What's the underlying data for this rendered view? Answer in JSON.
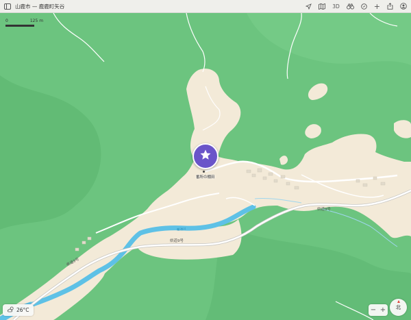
{
  "window": {
    "title": "山鹿市 — 鹿鹿町矢谷",
    "toolbar": {
      "sidebar_icon": "sidebar-icon",
      "location_icon": "location-arrow-icon",
      "map_mode_icon": "map-icon",
      "three_d_label": "3D",
      "binoculars_icon": "binoculars-icon",
      "guides_icon": "guides-icon",
      "add_label": "+",
      "share_icon": "share-icon",
      "account_icon": "person-icon"
    }
  },
  "map": {
    "scale": {
      "start": "0",
      "end": "125 m"
    },
    "place": {
      "name": "番所の棚田",
      "icon": "star-icon",
      "color": "#6a55c9"
    },
    "roads": [
      {
        "label": "県道9号"
      },
      {
        "label": "県道9号"
      },
      {
        "label": "県道9号"
      },
      {
        "label": "菊池川"
      }
    ],
    "colors": {
      "forest": "#6cc47f",
      "terrain": "#f3ead8",
      "water": "#5ec1e6",
      "road": "#ffffff"
    }
  },
  "controls": {
    "weather": {
      "temperature": "26°C",
      "icon": "cloud-sun-icon"
    },
    "zoom": {
      "out": "−",
      "in": "+"
    },
    "compass": {
      "label": "北"
    }
  }
}
